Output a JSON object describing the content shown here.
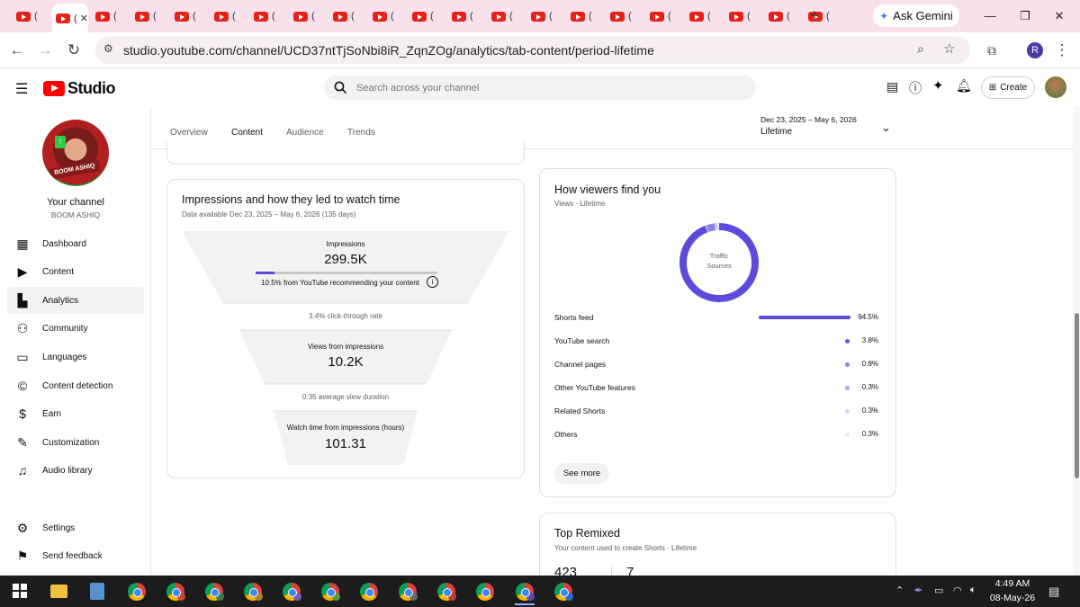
{
  "browser": {
    "tab_count_youtube": 21,
    "new_tab_label": "+",
    "ask_gemini": "Ask Gemini",
    "url": "studio.youtube.com/channel/UCD37ntTjSoNbi8iR_ZqnZOg/analytics/tab-content/period-lifetime",
    "profile_initial": "R"
  },
  "header": {
    "logo_text": "Studio",
    "search_placeholder": "Search across your channel",
    "create_label": "Create"
  },
  "sidebar": {
    "your_channel": "Your channel",
    "channel_name": "BOOM ASHIQ",
    "avatar_tag": "BOOM ASHIQ",
    "items": [
      {
        "label": "Dashboard",
        "icon": "dashboard-icon"
      },
      {
        "label": "Content",
        "icon": "content-icon"
      },
      {
        "label": "Analytics",
        "icon": "analytics-icon"
      },
      {
        "label": "Community",
        "icon": "community-icon"
      },
      {
        "label": "Languages",
        "icon": "languages-icon"
      },
      {
        "label": "Content detection",
        "icon": "copyright-icon"
      },
      {
        "label": "Earn",
        "icon": "dollar-icon"
      },
      {
        "label": "Customization",
        "icon": "magic-wand-icon"
      },
      {
        "label": "Audio library",
        "icon": "audio-library-icon"
      }
    ],
    "bottom_items": [
      {
        "label": "Settings",
        "icon": "settings-icon"
      },
      {
        "label": "Send feedback",
        "icon": "feedback-icon"
      }
    ]
  },
  "tabs": [
    "Overview",
    "Content",
    "Audience",
    "Trends"
  ],
  "active_tab": "Content",
  "date_range": {
    "range": "Dec 23, 2025 – May 6, 2026",
    "period": "Lifetime"
  },
  "funnel": {
    "title": "Impressions and how they led to watch time",
    "subtitle": "Data available Dec 23, 2025 – May 6, 2026 (135 days)",
    "impressions_label": "Impressions",
    "impressions_value": "299.5K",
    "recommend_text": "10.5% from YouTube recommending your content",
    "recommend_fraction": 0.105,
    "ctr_text": "3.4% click-through rate",
    "views_label": "Views from impressions",
    "views_value": "10.2K",
    "avd_text": "0:35 average view duration",
    "watch_label": "Watch time from impressions (hours)",
    "watch_value": "101.31"
  },
  "traffic": {
    "title": "How viewers find you",
    "subtitle": "Views · Lifetime",
    "donut_label_1": "Traffic",
    "donut_label_2": "Sources",
    "accent": "#5c4bdb",
    "sources": [
      {
        "label": "Shorts feed",
        "pct": "94.5%",
        "value": 94.5
      },
      {
        "label": "YouTube search",
        "pct": "3.8%",
        "value": 3.8
      },
      {
        "label": "Channel pages",
        "pct": "0.8%",
        "value": 0.8
      },
      {
        "label": "Other YouTube features",
        "pct": "0.3%",
        "value": 0.3
      },
      {
        "label": "Related Shorts",
        "pct": "0.3%",
        "value": 0.3
      },
      {
        "label": "Others",
        "pct": "0.3%",
        "value": 0.3
      }
    ],
    "see_more": "See more"
  },
  "remixed": {
    "title": "Top Remixed",
    "subtitle": "Your content used to create Shorts · Lifetime",
    "value_1": "423",
    "value_2": "7"
  },
  "taskbar": {
    "time": "4:49 AM",
    "date": "08-May-26"
  }
}
